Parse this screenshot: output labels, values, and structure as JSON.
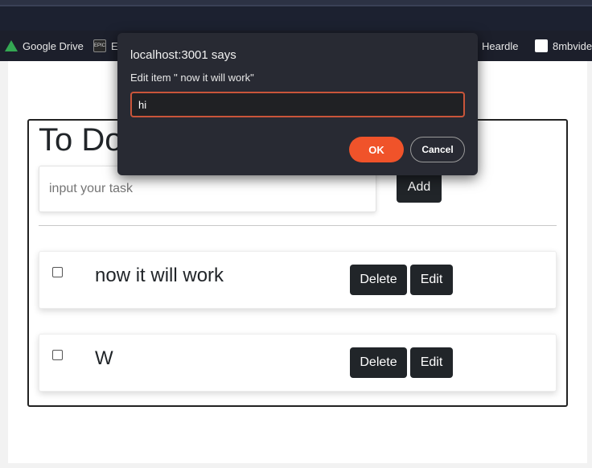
{
  "browser": {
    "bookmarks": [
      {
        "label": "Google Drive",
        "icon": "google-drive-icon"
      },
      {
        "label": "Ep",
        "icon": "epic-games-icon"
      },
      {
        "label": "Heardle",
        "icon": "heardle-icon"
      },
      {
        "label": "8mbvide",
        "icon": "8mb-icon"
      }
    ]
  },
  "app": {
    "title": "To Do",
    "input_placeholder": "input your task",
    "add_label": "Add",
    "items": [
      {
        "text": "now it will work",
        "delete_label": "Delete",
        "edit_label": "Edit",
        "checked": false
      },
      {
        "text": "W",
        "delete_label": "Delete",
        "edit_label": "Edit",
        "checked": false
      }
    ]
  },
  "dialog": {
    "title": "localhost:3001 says",
    "message": "Edit item \" now it will work\"",
    "input_value": "hi",
    "ok_label": "OK",
    "cancel_label": "Cancel",
    "accent_color": "#f0532a"
  }
}
